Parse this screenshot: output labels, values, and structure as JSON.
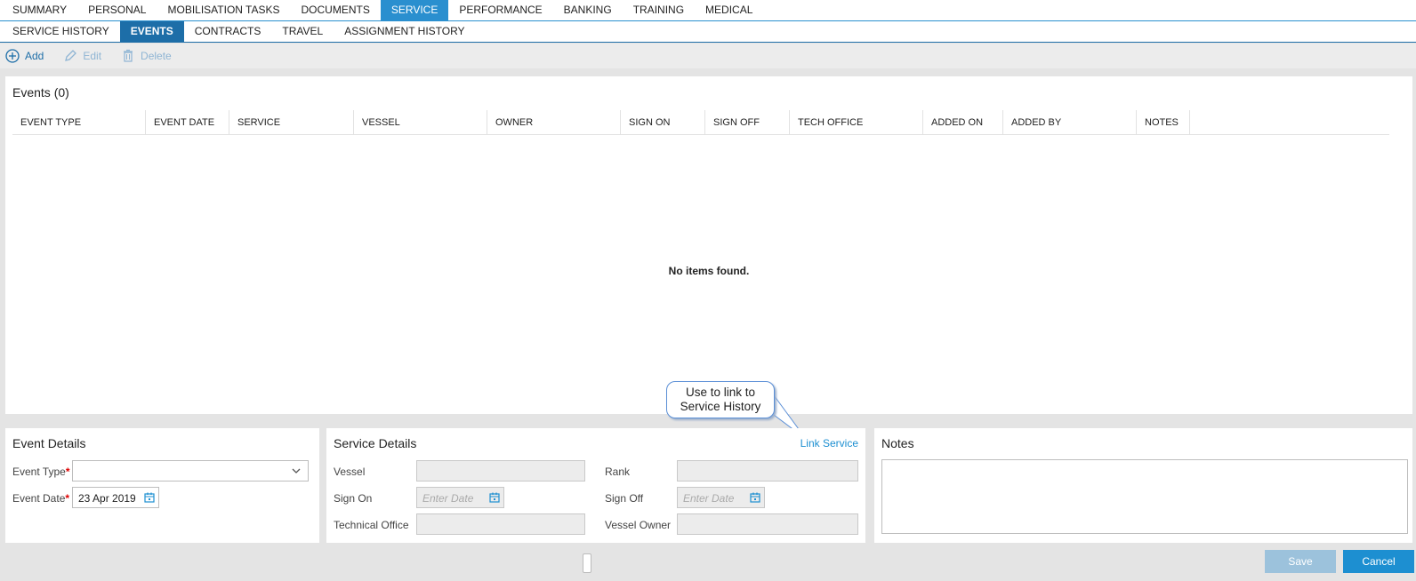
{
  "main_tabs": [
    {
      "label": "SUMMARY"
    },
    {
      "label": "PERSONAL"
    },
    {
      "label": "MOBILISATION TASKS"
    },
    {
      "label": "DOCUMENTS"
    },
    {
      "label": "SERVICE",
      "active": true
    },
    {
      "label": "PERFORMANCE"
    },
    {
      "label": "BANKING"
    },
    {
      "label": "TRAINING"
    },
    {
      "label": "MEDICAL"
    }
  ],
  "sub_tabs": [
    {
      "label": "SERVICE HISTORY"
    },
    {
      "label": "EVENTS",
      "active": true
    },
    {
      "label": "CONTRACTS"
    },
    {
      "label": "TRAVEL"
    },
    {
      "label": "ASSIGNMENT HISTORY"
    }
  ],
  "toolbar": {
    "add_label": "Add",
    "edit_label": "Edit",
    "delete_label": "Delete"
  },
  "events": {
    "title": "Events (0)",
    "columns": [
      "EVENT TYPE",
      "EVENT DATE",
      "SERVICE",
      "VESSEL",
      "OWNER",
      "SIGN ON",
      "SIGN OFF",
      "TECH OFFICE",
      "ADDED ON",
      "ADDED BY",
      "NOTES"
    ],
    "empty_message": "No items found."
  },
  "callout": {
    "line1": "Use to link to",
    "line2": "Service History"
  },
  "event_details": {
    "title": "Event Details",
    "event_type_label": "Event Type",
    "event_type_value": "",
    "event_date_label": "Event Date",
    "event_date_value": "23 Apr 2019",
    "required_mark": "*"
  },
  "service_details": {
    "title": "Service Details",
    "link_label": "Link Service",
    "vessel_label": "Vessel",
    "rank_label": "Rank",
    "sign_on_label": "Sign On",
    "sign_on_placeholder": "Enter Date",
    "sign_off_label": "Sign Off",
    "sign_off_placeholder": "Enter Date",
    "tech_office_label": "Technical Office",
    "vessel_owner_label": "Vessel Owner"
  },
  "notes": {
    "title": "Notes"
  },
  "footer": {
    "save_label": "Save",
    "cancel_label": "Cancel"
  },
  "colors": {
    "accent": "#2a8fcf",
    "accent_dark": "#1d6ea8",
    "required": "#dd0000",
    "disabled_button": "#9cc2dc"
  }
}
